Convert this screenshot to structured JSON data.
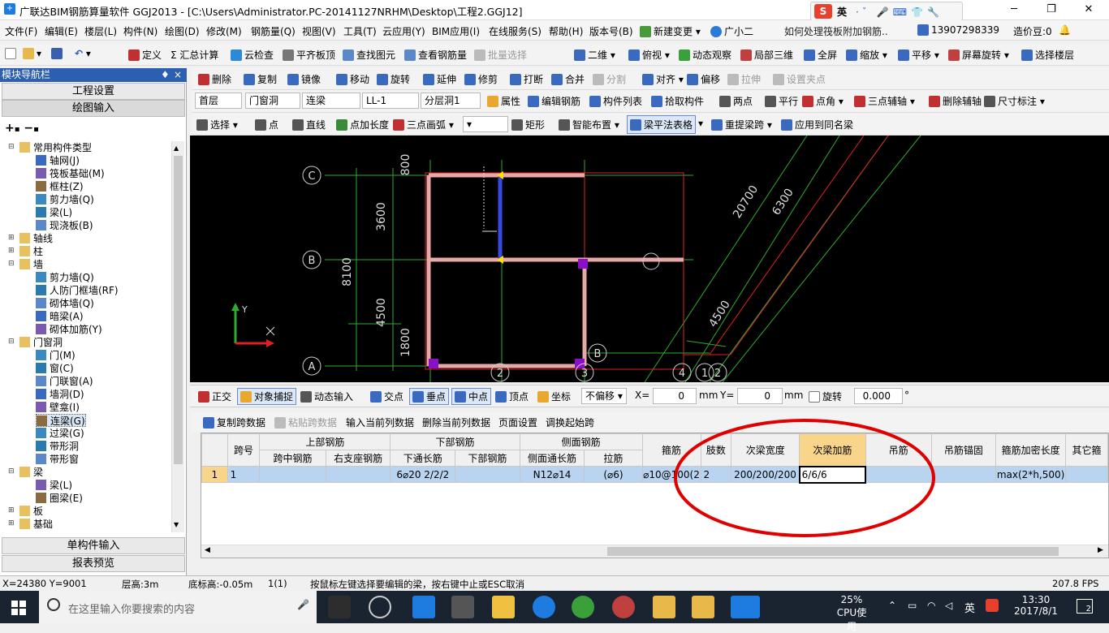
{
  "title_bar": {
    "title": "广联达BIM钢筋算量软件 GGJ2013 - [C:\\Users\\Administrator.PC-20141127NRHM\\Desktop\\工程2.GGJ12]",
    "ime_label": "英",
    "ime_glyphs": "·゛🎤⌨👕🔧"
  },
  "menu": {
    "items": [
      "文件(F)",
      "编辑(E)",
      "楼层(L)",
      "构件(N)",
      "绘图(D)",
      "修改(M)",
      "钢筋量(Q)",
      "视图(V)",
      "工具(T)",
      "云应用(Y)",
      "BIM应用(I)",
      "在线服务(S)",
      "帮助(H)",
      "版本号(B)",
      "新建变更 ▾",
      "广小二"
    ],
    "help_question": "如何处理筏板附加钢筋..",
    "phone": "13907298339",
    "beans": "造价豆:0"
  },
  "toolbar1": [
    "定义",
    "Σ 汇总计算",
    "云检查",
    "平齐板顶",
    "查找图元",
    "查看钢筋量",
    "批量选择",
    "二维",
    "俯视",
    "动态观察",
    "局部三维",
    "全屏",
    "缩放",
    "平移",
    "屏幕旋转",
    "选择楼层"
  ],
  "toolbar2": [
    "删除",
    "复制",
    "镜像",
    "移动",
    "旋转",
    "延伸",
    "修剪",
    "打断",
    "合并",
    "分割",
    "对齐",
    "偏移",
    "拉伸",
    "设置夹点"
  ],
  "toolbar3": {
    "floor": "首层",
    "category": "门窗洞",
    "type": "连梁",
    "name": "LL-1",
    "layer": "分层洞1",
    "buttons": [
      "属性",
      "编辑钢筋",
      "构件列表",
      "拾取构件",
      "两点",
      "平行",
      "点角",
      "三点辅轴",
      "删除辅轴",
      "尺寸标注"
    ]
  },
  "toolbar4": [
    "选择",
    "点",
    "直线",
    "点加长度",
    "三点画弧",
    "矩形",
    "智能布置",
    "梁平法表格",
    "重提梁跨",
    "应用到同名梁"
  ],
  "nav": {
    "header": "模块导航栏",
    "project_settings": "工程设置",
    "drawing_input": "绘图输入",
    "single_input": "单构件输入",
    "report_preview": "报表预览",
    "tree": [
      {
        "level": 0,
        "exp": "⊟",
        "label": "常用构件类型"
      },
      {
        "level": 1,
        "label": "轴网(J)"
      },
      {
        "level": 1,
        "label": "筏板基础(M)"
      },
      {
        "level": 1,
        "label": "框柱(Z)"
      },
      {
        "level": 1,
        "label": "剪力墙(Q)"
      },
      {
        "level": 1,
        "label": "梁(L)"
      },
      {
        "level": 1,
        "label": "现浇板(B)"
      },
      {
        "level": 0,
        "exp": "⊞",
        "label": "轴线"
      },
      {
        "level": 0,
        "exp": "⊞",
        "label": "柱"
      },
      {
        "level": 0,
        "exp": "⊟",
        "label": "墙"
      },
      {
        "level": 1,
        "label": "剪力墙(Q)"
      },
      {
        "level": 1,
        "label": "人防门框墙(RF)"
      },
      {
        "level": 1,
        "label": "砌体墙(Q)"
      },
      {
        "level": 1,
        "label": "暗梁(A)"
      },
      {
        "level": 1,
        "label": "砌体加筋(Y)"
      },
      {
        "level": 0,
        "exp": "⊟",
        "label": "门窗洞"
      },
      {
        "level": 1,
        "label": "门(M)"
      },
      {
        "level": 1,
        "label": "窗(C)"
      },
      {
        "level": 1,
        "label": "门联窗(A)"
      },
      {
        "level": 1,
        "label": "墙洞(D)"
      },
      {
        "level": 1,
        "label": "壁龛(I)"
      },
      {
        "level": 1,
        "label": "连梁(G)",
        "selected": true
      },
      {
        "level": 1,
        "label": "过梁(G)"
      },
      {
        "level": 1,
        "label": "带形洞"
      },
      {
        "level": 1,
        "label": "带形窗"
      },
      {
        "level": 0,
        "exp": "⊟",
        "label": "梁"
      },
      {
        "level": 1,
        "label": "梁(L)"
      },
      {
        "level": 1,
        "label": "圈梁(E)"
      },
      {
        "level": 0,
        "exp": "⊞",
        "label": "板"
      },
      {
        "level": 0,
        "exp": "⊞",
        "label": "基础"
      }
    ]
  },
  "cad": {
    "axis_labels": [
      "C",
      "B",
      "A",
      "B",
      "2",
      "3",
      "4",
      "1",
      "2"
    ],
    "dims": [
      "800",
      "3600",
      "8100",
      "4500",
      "1800",
      "20700",
      "6300",
      "4500"
    ],
    "ucs_y": "Y"
  },
  "snapbar": {
    "items": [
      "正交",
      "对象捕捉",
      "动态输入",
      "交点",
      "垂点",
      "中点",
      "顶点",
      "坐标"
    ],
    "offset": "不偏移",
    "x_label": "X=",
    "x_val": "0",
    "y_label": "Y=",
    "y_val": "0",
    "unit": "mm",
    "rotate_label": "旋转",
    "rotate_val": "0.000",
    "deg": "°"
  },
  "tablebar": [
    "复制跨数据",
    "粘贴跨数据",
    "输入当前列数据",
    "删除当前列数据",
    "页面设置",
    "调换起始跨"
  ],
  "grid": {
    "group_headers": [
      "跨号",
      "上部钢筋",
      "下部钢筋",
      "侧面钢筋",
      "箍筋",
      "肢数",
      "次梁宽度",
      "次梁加筋",
      "吊筋",
      "吊筋锚固",
      "箍筋加密长度",
      "其它箍"
    ],
    "sub_headers": [
      "跨中钢筋",
      "右支座钢筋",
      "下通长筋",
      "下部钢筋",
      "侧面通长筋",
      "拉筋"
    ],
    "row": [
      "1",
      "1",
      "",
      "",
      "6⌀20 2/2/2",
      "",
      "N12⌀14",
      "(⌀6)",
      "⌀10@100(2",
      "2",
      "200/200/200",
      "6/6/6",
      "",
      "",
      "max(2*h,500)",
      ""
    ]
  },
  "status": {
    "coords": "X=24380 Y=9001",
    "floor_height": "层高:3m",
    "base_height": "底标高:-0.05m",
    "index": "1(1)",
    "hint": "按鼠标左键选择要编辑的梁，按右键中止或ESC取消",
    "fps": "207.8 FPS"
  },
  "taskbar": {
    "search_placeholder": "在这里输入你要搜索的内容",
    "cpu_percent": "25%",
    "cpu_label": "CPU使用",
    "ime": "英",
    "time": "13:30",
    "date": "2017/8/1",
    "notif": "2"
  },
  "colors": {
    "nav_header": "#2c5fb0",
    "selected_row": "#b8d4f0",
    "highlight_header": "#f8d58a",
    "annotation_ellipse": "#e00000"
  }
}
